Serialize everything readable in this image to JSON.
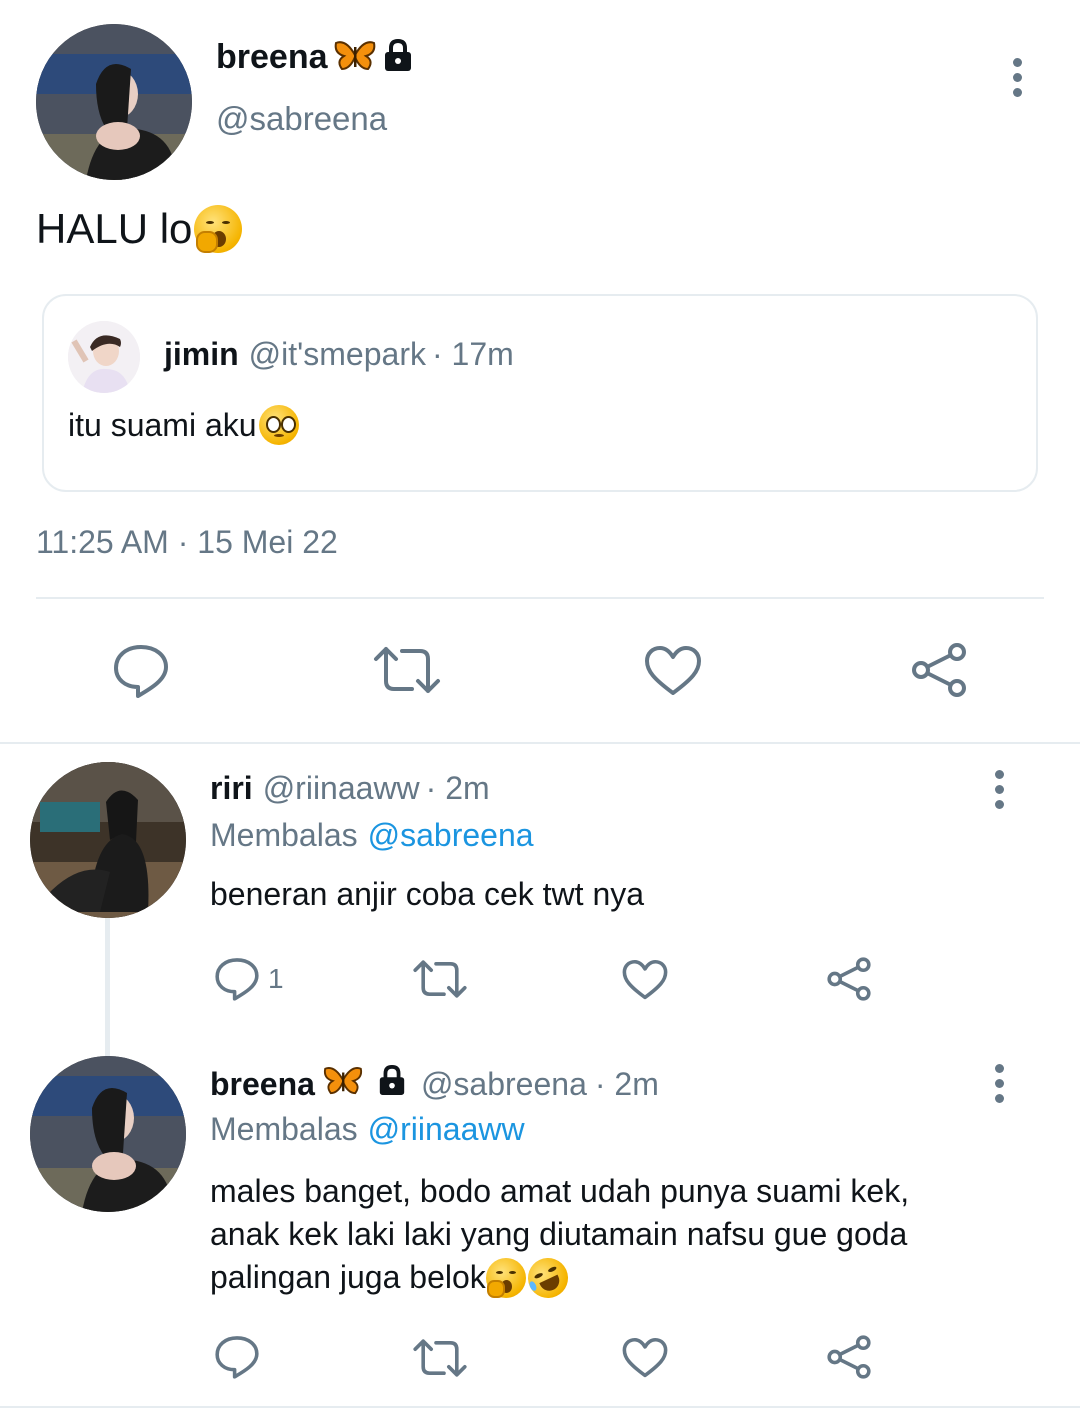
{
  "main_tweet": {
    "display_name": "breena",
    "handle": "@sabreena",
    "text": "HALU lo",
    "timestamp": "11:25 AM · 15 Mei 22",
    "name_icons": [
      "butterfly-icon",
      "lock-icon"
    ],
    "text_emoji": "yawning-face-emoji",
    "quoted": {
      "display_name": "jimin",
      "handle": "@it'smepark",
      "time": "· 17m",
      "text": "itu suami aku",
      "text_emoji": "pleading-face-emoji"
    }
  },
  "replies": [
    {
      "display_name": "riri",
      "handle": "@riinaaww",
      "time": "· 2m",
      "replying_prefix": "Membalas",
      "replying_to": "@sabreena",
      "text": "beneran anjir coba cek twt nya",
      "reply_count": "1"
    },
    {
      "display_name": "breena",
      "handle": "@sabreena",
      "time": "· 2m",
      "replying_prefix": "Membalas",
      "replying_to": "@riinaaww",
      "text_lines": [
        "males banget, bodo amat udah punya suami kek,",
        "anak kek laki laki yang diutamain nafsu gue goda",
        "palingan juga belok"
      ],
      "name_icons": [
        "butterfly-icon",
        "lock-icon"
      ],
      "text_emojis": [
        "yawning-face-emoji",
        "rolling-laughing-emoji"
      ]
    }
  ],
  "colors": {
    "text": "#0f1419",
    "muted": "#657786",
    "link": "#1b95e0",
    "divider": "#e6ecf0",
    "butterfly": "#f4900c"
  }
}
